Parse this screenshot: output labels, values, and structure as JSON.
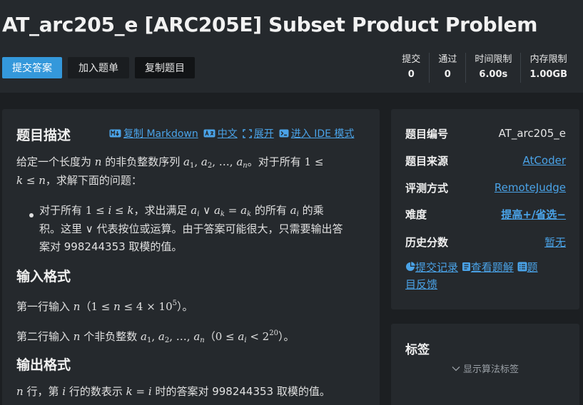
{
  "header": {
    "title": "AT_arc205_e [ARC205E] Subset Product Problem",
    "buttons": {
      "submit": "提交答案",
      "add_list": "加入题单",
      "copy": "复制题目"
    },
    "stats": [
      {
        "label": "提交",
        "value": "0"
      },
      {
        "label": "通过",
        "value": "0"
      },
      {
        "label": "时间限制",
        "value": "6.00s"
      },
      {
        "label": "内存限制",
        "value": "1.00GB"
      }
    ]
  },
  "problem": {
    "description_heading": "题目描述",
    "toolbar": {
      "copy_markdown": "复制 Markdown",
      "chinese": "中文",
      "expand": "展开",
      "ide": "进入 IDE 模式"
    },
    "desc": {
      "l1a": "给定一个长度为",
      "l1b": "的非负整数序列",
      "l1c": "。对于所有",
      "l2": "，求解下面的问题：",
      "b1a": "对于所有",
      "b1b": "，求出满足",
      "b1c": "的所有",
      "b1d": "的乘",
      "b2": "积。这里 ∨ 代表按位或运算。由于答案可能很大，只需要输出答",
      "b3": "案对 998244353 取模的值。"
    },
    "input_heading": "输入格式",
    "input": {
      "l1a": "第一行输入",
      "l1b": "。",
      "l2a": "第二行输入",
      "l2b": "个非负整数",
      "l2c": "。"
    },
    "output_heading": "输出格式",
    "output": {
      "a": "行，第",
      "b": "行的数表示",
      "c": "时的答案对 998244353 取模的值。"
    }
  },
  "sidebar": {
    "info": [
      {
        "key": "题目编号",
        "value": "AT_arc205_e"
      },
      {
        "key": "题目来源",
        "value": "AtCoder"
      },
      {
        "key": "评测方式",
        "value": "RemoteJudge"
      },
      {
        "key": "难度",
        "value": "提高+/省选−"
      },
      {
        "key": "历史分数",
        "value": "暂无"
      }
    ],
    "links": {
      "records": "提交记录",
      "solutions": "查看题解",
      "feedback_a": "题",
      "feedback_b": "目反馈"
    },
    "tags_heading": "标签",
    "show_tags": "显示算法标签"
  },
  "colors": {
    "accent": "#3498db",
    "link": "#4aa3e8",
    "panel": "#25292d",
    "background": "#1c1f22"
  }
}
